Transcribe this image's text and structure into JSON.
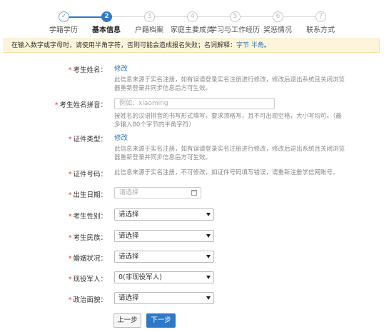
{
  "steps": [
    {
      "num": "✓",
      "label": "学籍学历",
      "state": "done"
    },
    {
      "num": "2",
      "label": "基本信息",
      "state": "active"
    },
    {
      "num": "3",
      "label": "户籍档案",
      "state": "todo"
    },
    {
      "num": "4",
      "label": "家庭主要成员",
      "state": "todo"
    },
    {
      "num": "5",
      "label": "学习与工作经历",
      "state": "todo"
    },
    {
      "num": "6",
      "label": "奖惩情况",
      "state": "todo"
    },
    {
      "num": "7",
      "label": "联系方式",
      "state": "todo"
    }
  ],
  "notice": {
    "text": "在输入数字或字母时，请使用半角字符，否则可能会造成报名失败；名词解释：",
    "link1": "字节",
    "link2": "半角",
    "suffix": "。"
  },
  "fields": {
    "name": {
      "label": "考生姓名：",
      "action": "修改",
      "hint": "此信息来源于实名注册，如有误请登录实名注册进行修改，修改后退出系统且关闭浏览器重新登录并同步信息后方可生效。"
    },
    "pinyin": {
      "label": "考生姓名拼音：",
      "placeholder": "例如：xiaoming",
      "hint": "按姓名的汉语拼音的书写形式填写，要求顶格写，且不可出现空格，大小写均可。（最多输入80个字节的半角字符）"
    },
    "id_type": {
      "label": "证件类型：",
      "action": "修改",
      "hint": "此信息来源于实名注册，如有误请登录实名注册进行修改，修改后退出系统且关闭浏览器重新登录并同步信息后方可生效。"
    },
    "id_no": {
      "label": "证件号码：",
      "hint": "此信息来源于实名注册，不可修改，如证件号码填写错误，请重新注册学信网账号。"
    },
    "birth": {
      "label": "出生日期：",
      "placeholder": "请选择"
    },
    "gender": {
      "label": "考生性别：",
      "value": "请选择"
    },
    "ethnicity": {
      "label": "考生民族：",
      "value": "请选择"
    },
    "marital": {
      "label": "婚姻状况：",
      "value": "请选择"
    },
    "military": {
      "label": "现役军人：",
      "value": "0(非现役军人)"
    },
    "political": {
      "label": "政治面貌：",
      "value": "请选择"
    }
  },
  "buttons": {
    "prev": "上一步",
    "next": "下一步"
  },
  "colors": {
    "accent": "#2d79c7",
    "required": "#e03b2e",
    "notice_bg": "#fdf5d9"
  }
}
